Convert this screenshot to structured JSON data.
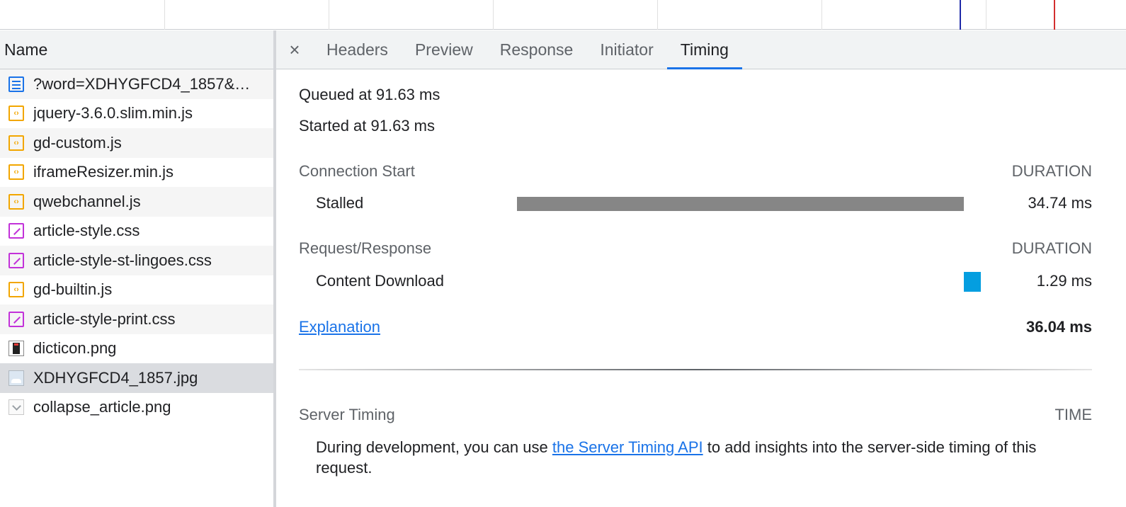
{
  "file_list": {
    "header": "Name",
    "files": [
      {
        "name": "?word=XDHYGFCD4_1857&…",
        "icon": "document-icon",
        "kind": "doc"
      },
      {
        "name": "jquery-3.6.0.slim.min.js",
        "icon": "script-icon",
        "kind": "js"
      },
      {
        "name": "gd-custom.js",
        "icon": "script-icon",
        "kind": "js"
      },
      {
        "name": "iframeResizer.min.js",
        "icon": "script-icon",
        "kind": "js"
      },
      {
        "name": "qwebchannel.js",
        "icon": "script-icon",
        "kind": "js"
      },
      {
        "name": "article-style.css",
        "icon": "stylesheet-icon",
        "kind": "css"
      },
      {
        "name": "article-style-st-lingoes.css",
        "icon": "stylesheet-icon",
        "kind": "css"
      },
      {
        "name": "gd-builtin.js",
        "icon": "script-icon",
        "kind": "js"
      },
      {
        "name": "article-style-print.css",
        "icon": "stylesheet-icon",
        "kind": "css"
      },
      {
        "name": "dicticon.png",
        "icon": "image-icon",
        "kind": "png-dark"
      },
      {
        "name": "XDHYGFCD4_1857.jpg",
        "icon": "image-icon",
        "kind": "jpg",
        "selected": true
      },
      {
        "name": "collapse_article.png",
        "icon": "image-icon",
        "kind": "collapse"
      }
    ]
  },
  "tabs": {
    "close_symbol": "×",
    "items": [
      {
        "label": "Headers",
        "active": false
      },
      {
        "label": "Preview",
        "active": false
      },
      {
        "label": "Response",
        "active": false
      },
      {
        "label": "Initiator",
        "active": false
      },
      {
        "label": "Timing",
        "active": true
      }
    ]
  },
  "timing": {
    "queued": "Queued at 91.63 ms",
    "started": "Started at 91.63 ms",
    "connection_start": {
      "title": "Connection Start",
      "duration_header": "DURATION",
      "stalled_label": "Stalled",
      "stalled_value": "34.74 ms"
    },
    "request_response": {
      "title": "Request/Response",
      "duration_header": "DURATION",
      "download_label": "Content Download",
      "download_value": "1.29 ms"
    },
    "explanation_link": "Explanation",
    "total": "36.04 ms",
    "server_timing": {
      "title": "Server Timing",
      "time_header": "TIME",
      "text_before": "During development, you can use ",
      "link": "the Server Timing API",
      "text_after": " to add insights into the server-side timing of this request."
    }
  },
  "colors": {
    "stalled_bar": "#868686",
    "download_bar": "#049ee0",
    "active_tab_underline": "#1a73e8",
    "overview_marker_blue": "#1f2aa8",
    "overview_marker_red": "#d32f2f"
  }
}
